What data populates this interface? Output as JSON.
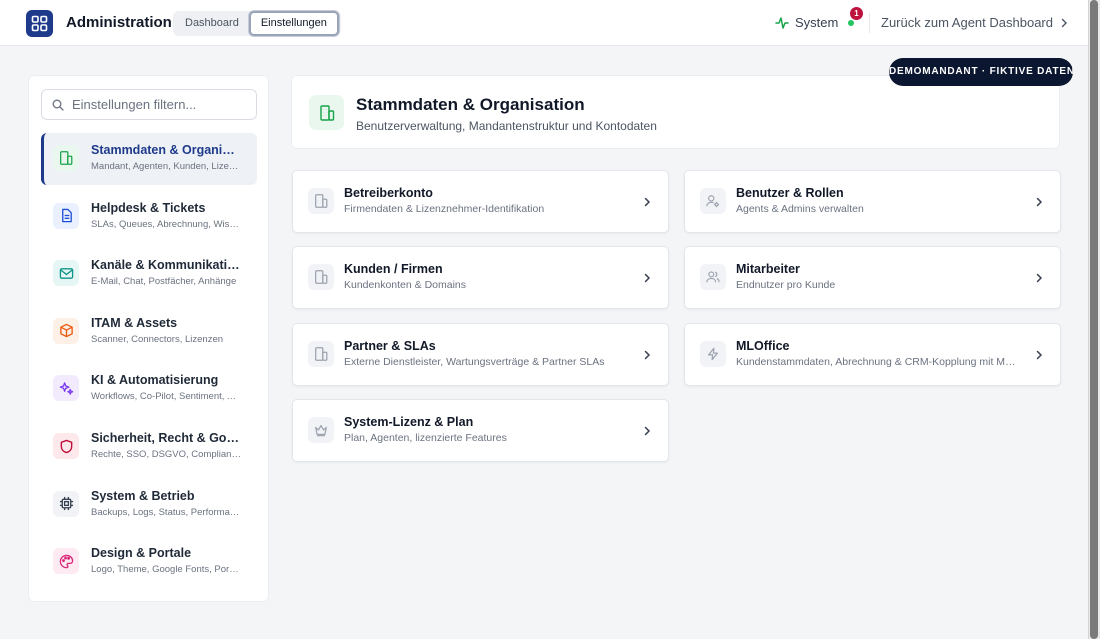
{
  "header": {
    "app_title": "Administration",
    "tabs": [
      {
        "label": "Dashboard",
        "active": false
      },
      {
        "label": "Einstellungen",
        "active": true
      }
    ],
    "system_label": "System",
    "notification_count": "1",
    "back_link": "Zurück zum Agent Dashboard",
    "demo_badge": "DEMOMANDANT · FIKTIVE DATEN"
  },
  "sidebar": {
    "filter_placeholder": "Einstellungen filtern...",
    "items": [
      {
        "title": "Stammdaten & Organisation",
        "subtitle": "Mandant, Agenten, Kunden, Lizenzen",
        "icon": "building-icon",
        "color": "#16a34a",
        "bg": "#e9f7ee",
        "active": true
      },
      {
        "title": "Helpdesk & Tickets",
        "subtitle": "SLAs, Queues, Abrechnung, Wissensdatenbank",
        "icon": "document-icon",
        "color": "#1d4ed8",
        "bg": "#eaf0fd",
        "active": false
      },
      {
        "title": "Kanäle & Kommunikation",
        "subtitle": "E-Mail, Chat, Postfächer, Anhänge",
        "icon": "mail-icon",
        "color": "#0d9488",
        "bg": "#e6f6f4",
        "active": false
      },
      {
        "title": "ITAM & Assets",
        "subtitle": "Scanner, Connectors, Lizenzen",
        "icon": "cube-icon",
        "color": "#ea580c",
        "bg": "#fdf0e7",
        "active": false
      },
      {
        "title": "KI & Automatisierung",
        "subtitle": "Workflows, Co-Pilot, Sentiment, Auto-Tagging",
        "icon": "sparkles-icon",
        "color": "#7c3aed",
        "bg": "#f1ebfd",
        "active": false
      },
      {
        "title": "Sicherheit, Recht & Governance",
        "subtitle": "Rechte, SSO, DSGVO, Compliance",
        "icon": "shield-icon",
        "color": "#be123c",
        "bg": "#fde9ec",
        "active": false
      },
      {
        "title": "System & Betrieb",
        "subtitle": "Backups, Logs, Status, Performance",
        "icon": "chip-icon",
        "color": "#374151",
        "bg": "#f1f3f6",
        "active": false
      },
      {
        "title": "Design & Portale",
        "subtitle": "Logo, Theme, Google Fonts, Portale",
        "icon": "palette-icon",
        "color": "#db2777",
        "bg": "#fdeaf2",
        "active": false
      }
    ]
  },
  "section": {
    "title": "Stammdaten & Organisation",
    "subtitle": "Benutzerverwaltung, Mandantenstruktur und Kontodaten"
  },
  "cards": [
    {
      "title": "Betreiberkonto",
      "subtitle": "Firmendaten & Lizenznehmer-Identifikation",
      "icon": "building-icon"
    },
    {
      "title": "Benutzer & Rollen",
      "subtitle": "Agents & Admins verwalten",
      "icon": "user-cog-icon"
    },
    {
      "title": "Kunden / Firmen",
      "subtitle": "Kundenkonten & Domains",
      "icon": "building-icon"
    },
    {
      "title": "Mitarbeiter",
      "subtitle": "Endnutzer pro Kunde",
      "icon": "users-icon"
    },
    {
      "title": "Partner & SLAs",
      "subtitle": "Externe Dienstleister, Wartungsverträge & Partner SLAs",
      "icon": "building-icon"
    },
    {
      "title": "MLOffice",
      "subtitle": "Kundenstammdaten, Abrechnung & CRM-Kopplung mit MLOffice",
      "icon": "bolt-icon"
    },
    {
      "title": "System-Lizenz & Plan",
      "subtitle": "Plan, Agenten, lizenzierte Features",
      "icon": "crown-icon"
    }
  ],
  "colors": {
    "brand": "#1e3a8a",
    "accent_green": "#16a34a",
    "status_ok": "#22c55e",
    "badge_red": "#be123c",
    "demo_badge_bg": "#0b1730"
  }
}
